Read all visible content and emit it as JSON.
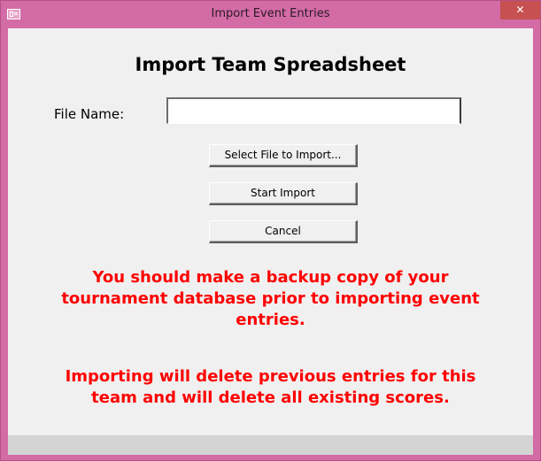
{
  "window": {
    "title": "Import Event Entries",
    "close_label": "✕"
  },
  "form": {
    "heading": "Import Team Spreadsheet",
    "file_label": "File Name:",
    "file_value": ""
  },
  "buttons": {
    "select_file": "Select File to Import...",
    "start_import": "Start Import",
    "cancel": "Cancel"
  },
  "warnings": {
    "backup": [
      "You should make a backup copy of your",
      "tournament database prior to importing event",
      "entries."
    ],
    "delete": [
      "Importing will delete previous entries for this",
      "team and will delete all existing scores."
    ]
  },
  "colors": {
    "titlebar": "#d36ba6",
    "close_button": "#c75050",
    "warning_text": "#ff0000",
    "client_background": "#f0f0f0"
  },
  "icons": {
    "window_icon": "form-window-icon",
    "close": "close-icon"
  }
}
